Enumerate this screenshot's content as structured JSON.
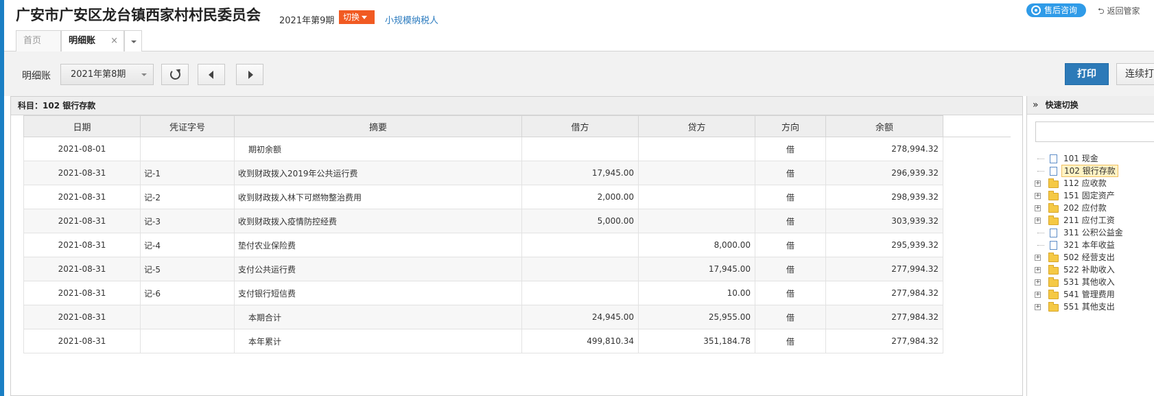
{
  "header": {
    "org_name": "广安市广安区龙台镇西家村村民委员会",
    "period": "2021年第9期",
    "switch_label": "切换",
    "taxpayer_type": "小规模纳税人",
    "support_label": "售后咨询",
    "back_label": "返回管家"
  },
  "tabs": [
    {
      "label": "首页"
    },
    {
      "label": "明细账",
      "close": "×"
    }
  ],
  "toolbar": {
    "label": "明细账",
    "period_select": "2021年第8期",
    "print_label": "打印",
    "continuous_print_label": "连续打印"
  },
  "subject": "科目：102  银行存款",
  "table": {
    "columns": [
      "日期",
      "凭证字号",
      "摘要",
      "借方",
      "贷方",
      "方向",
      "余额"
    ],
    "rows": [
      {
        "date": "2021-08-01",
        "voucher": "",
        "summary": "期初余额",
        "debit": "",
        "credit": "",
        "dir": "借",
        "balance": "278,994.32"
      },
      {
        "date": "2021-08-31",
        "voucher": "记-1",
        "summary": "收到财政拨入2019年公共运行费",
        "debit": "17,945.00",
        "credit": "",
        "dir": "借",
        "balance": "296,939.32"
      },
      {
        "date": "2021-08-31",
        "voucher": "记-2",
        "summary": "收到财政拨入林下可燃物整治费用",
        "debit": "2,000.00",
        "credit": "",
        "dir": "借",
        "balance": "298,939.32"
      },
      {
        "date": "2021-08-31",
        "voucher": "记-3",
        "summary": "收到财政拨入疫情防控经费",
        "debit": "5,000.00",
        "credit": "",
        "dir": "借",
        "balance": "303,939.32"
      },
      {
        "date": "2021-08-31",
        "voucher": "记-4",
        "summary": "垫付农业保险费",
        "debit": "",
        "credit": "8,000.00",
        "dir": "借",
        "balance": "295,939.32"
      },
      {
        "date": "2021-08-31",
        "voucher": "记-5",
        "summary": "支付公共运行费",
        "debit": "",
        "credit": "17,945.00",
        "dir": "借",
        "balance": "277,994.32"
      },
      {
        "date": "2021-08-31",
        "voucher": "记-6",
        "summary": "支付银行短信费",
        "debit": "",
        "credit": "10.00",
        "dir": "借",
        "balance": "277,984.32"
      },
      {
        "date": "2021-08-31",
        "voucher": "",
        "summary": "本期合计",
        "debit": "24,945.00",
        "credit": "25,955.00",
        "dir": "借",
        "balance": "277,984.32"
      },
      {
        "date": "2021-08-31",
        "voucher": "",
        "summary": "本年累计",
        "debit": "499,810.34",
        "credit": "351,184.78",
        "dir": "借",
        "balance": "277,984.32"
      }
    ]
  },
  "quick_switch": {
    "toggle": "»",
    "title": "快速切换",
    "search_value": "",
    "items": [
      {
        "label": "101 现金",
        "type": "file",
        "expandable": false,
        "selected": false
      },
      {
        "label": "102 银行存款",
        "type": "file",
        "expandable": false,
        "selected": true
      },
      {
        "label": "112 应收款",
        "type": "folder",
        "expandable": true,
        "selected": false
      },
      {
        "label": "151 固定资产",
        "type": "folder",
        "expandable": true,
        "selected": false
      },
      {
        "label": "202 应付款",
        "type": "folder",
        "expandable": true,
        "selected": false
      },
      {
        "label": "211 应付工资",
        "type": "folder",
        "expandable": true,
        "selected": false
      },
      {
        "label": "311 公积公益金",
        "type": "file",
        "expandable": false,
        "selected": false
      },
      {
        "label": "321 本年收益",
        "type": "file",
        "expandable": false,
        "selected": false
      },
      {
        "label": "502 经营支出",
        "type": "folder",
        "expandable": true,
        "selected": false
      },
      {
        "label": "522 补助收入",
        "type": "folder",
        "expandable": true,
        "selected": false
      },
      {
        "label": "531 其他收入",
        "type": "folder",
        "expandable": true,
        "selected": false
      },
      {
        "label": "541 管理费用",
        "type": "folder",
        "expandable": true,
        "selected": false
      },
      {
        "label": "551 其他支出",
        "type": "folder",
        "expandable": true,
        "selected": false
      }
    ]
  },
  "colors": {
    "accent": "#1a7fc4",
    "switch": "#f15a22",
    "print": "#2d7ab8",
    "support": "#2f9be8"
  }
}
